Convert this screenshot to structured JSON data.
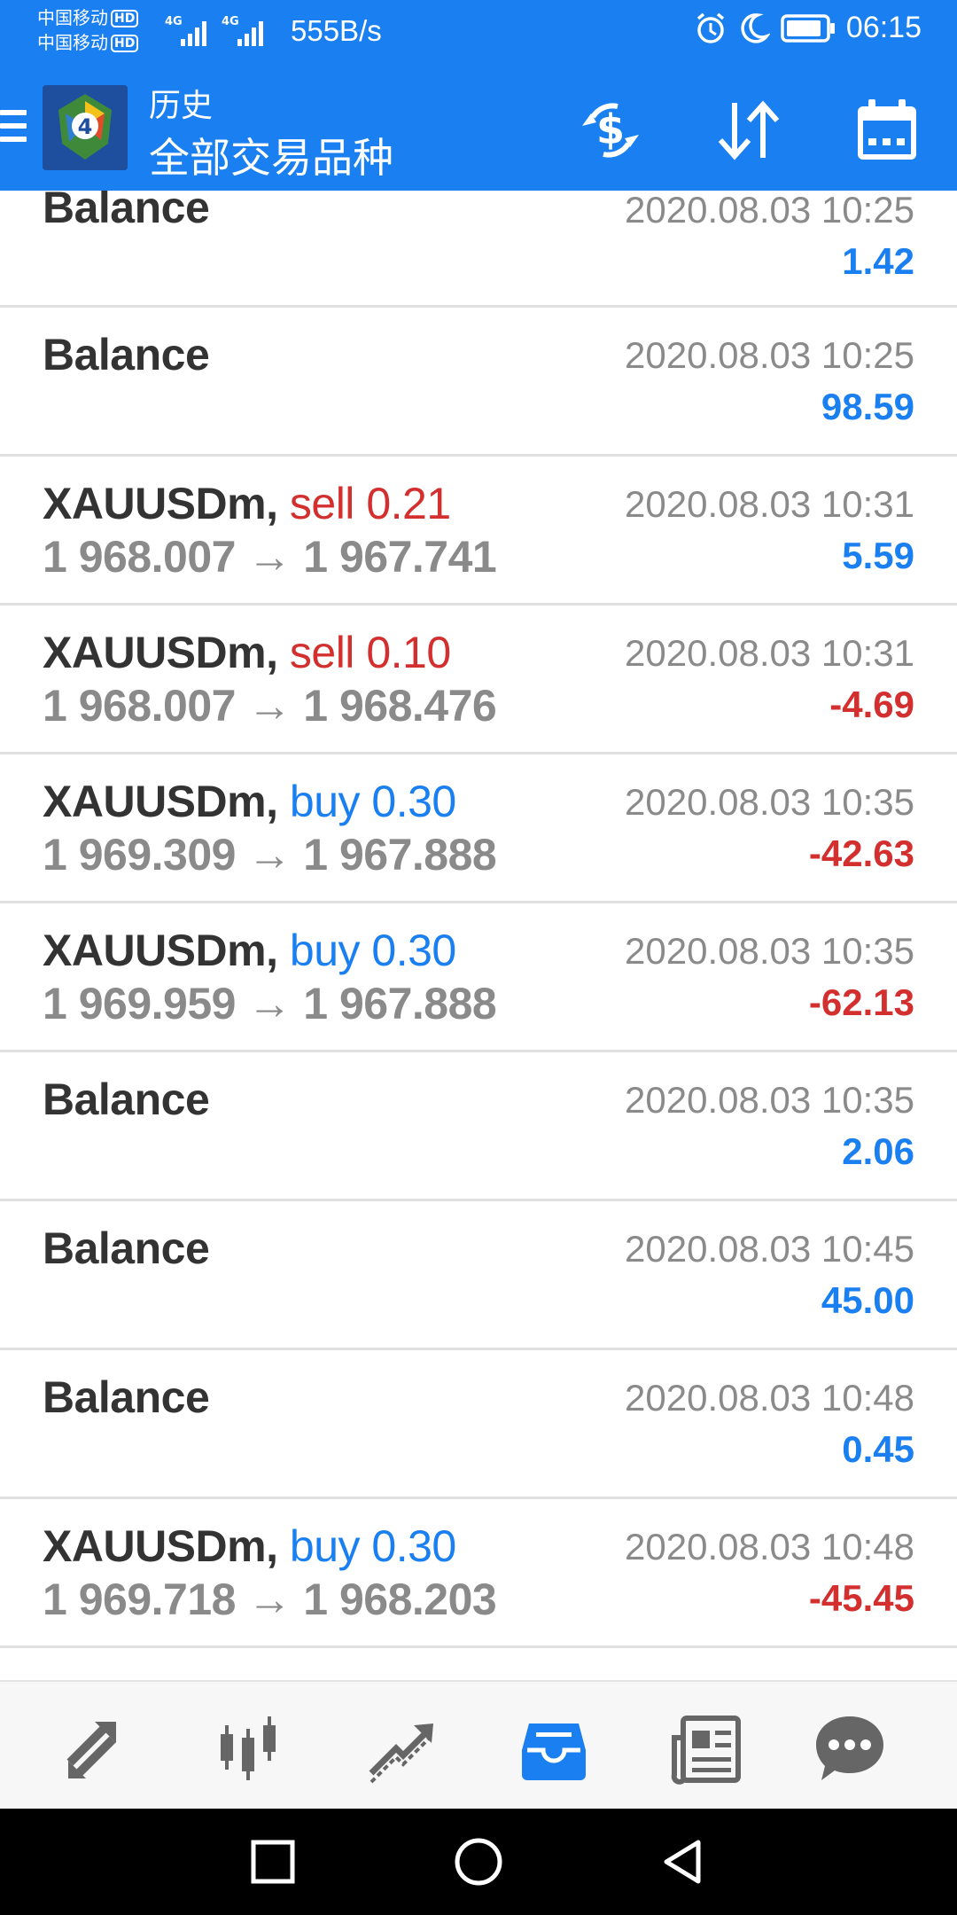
{
  "status_bar": {
    "carrier_1": "中国移动",
    "carrier_2": "中国移动",
    "hd_badge": "HD",
    "network": "4G",
    "net_speed": "555B/s",
    "time": "06:15"
  },
  "header": {
    "title": "历史",
    "subtitle": "全部交易品种",
    "actions": [
      "currency-exchange-icon",
      "sort-icon",
      "calendar-icon"
    ],
    "colors": {
      "bar": "#1a7ff0"
    }
  },
  "history": [
    {
      "symbol": "Balance",
      "time": "2020.08.03 10:25",
      "profit": "1.42",
      "sign": "pos"
    },
    {
      "symbol": "Balance",
      "time": "2020.08.03 10:25",
      "profit": "98.59",
      "sign": "pos"
    },
    {
      "symbol": "XAUUSDm,",
      "side": "sell",
      "volume": "0.21",
      "open": "1 968.007",
      "arrow": "→",
      "close": "1 967.741",
      "time": "2020.08.03 10:31",
      "profit": "5.59",
      "sign": "pos"
    },
    {
      "symbol": "XAUUSDm,",
      "side": "sell",
      "volume": "0.10",
      "open": "1 968.007",
      "arrow": "→",
      "close": "1 968.476",
      "time": "2020.08.03 10:31",
      "profit": "-4.69",
      "sign": "neg"
    },
    {
      "symbol": "XAUUSDm,",
      "side": "buy",
      "volume": "0.30",
      "open": "1 969.309",
      "arrow": "→",
      "close": "1 967.888",
      "time": "2020.08.03 10:35",
      "profit": "-42.63",
      "sign": "neg"
    },
    {
      "symbol": "XAUUSDm,",
      "side": "buy",
      "volume": "0.30",
      "open": "1 969.959",
      "arrow": "→",
      "close": "1 967.888",
      "time": "2020.08.03 10:35",
      "profit": "-62.13",
      "sign": "neg"
    },
    {
      "symbol": "Balance",
      "time": "2020.08.03 10:35",
      "profit": "2.06",
      "sign": "pos"
    },
    {
      "symbol": "Balance",
      "time": "2020.08.03 10:45",
      "profit": "45.00",
      "sign": "pos"
    },
    {
      "symbol": "Balance",
      "time": "2020.08.03 10:48",
      "profit": "0.45",
      "sign": "pos"
    },
    {
      "symbol": "XAUUSDm,",
      "side": "buy",
      "volume": "0.30",
      "open": "1 969.718",
      "arrow": "→",
      "close": "1 968.203",
      "time": "2020.08.03 10:48",
      "profit": "-45.45",
      "sign": "neg"
    }
  ],
  "colors": {
    "positive": "#1a7ff0",
    "negative": "#d32f2f",
    "muted": "#8a8a8a"
  },
  "bottom_nav": {
    "items": [
      "quotes-icon",
      "chart-icon",
      "trade-icon",
      "history-icon",
      "news-icon",
      "chat-icon"
    ],
    "active": "history-icon"
  },
  "system_nav": [
    "recents-button",
    "home-button",
    "back-button"
  ]
}
